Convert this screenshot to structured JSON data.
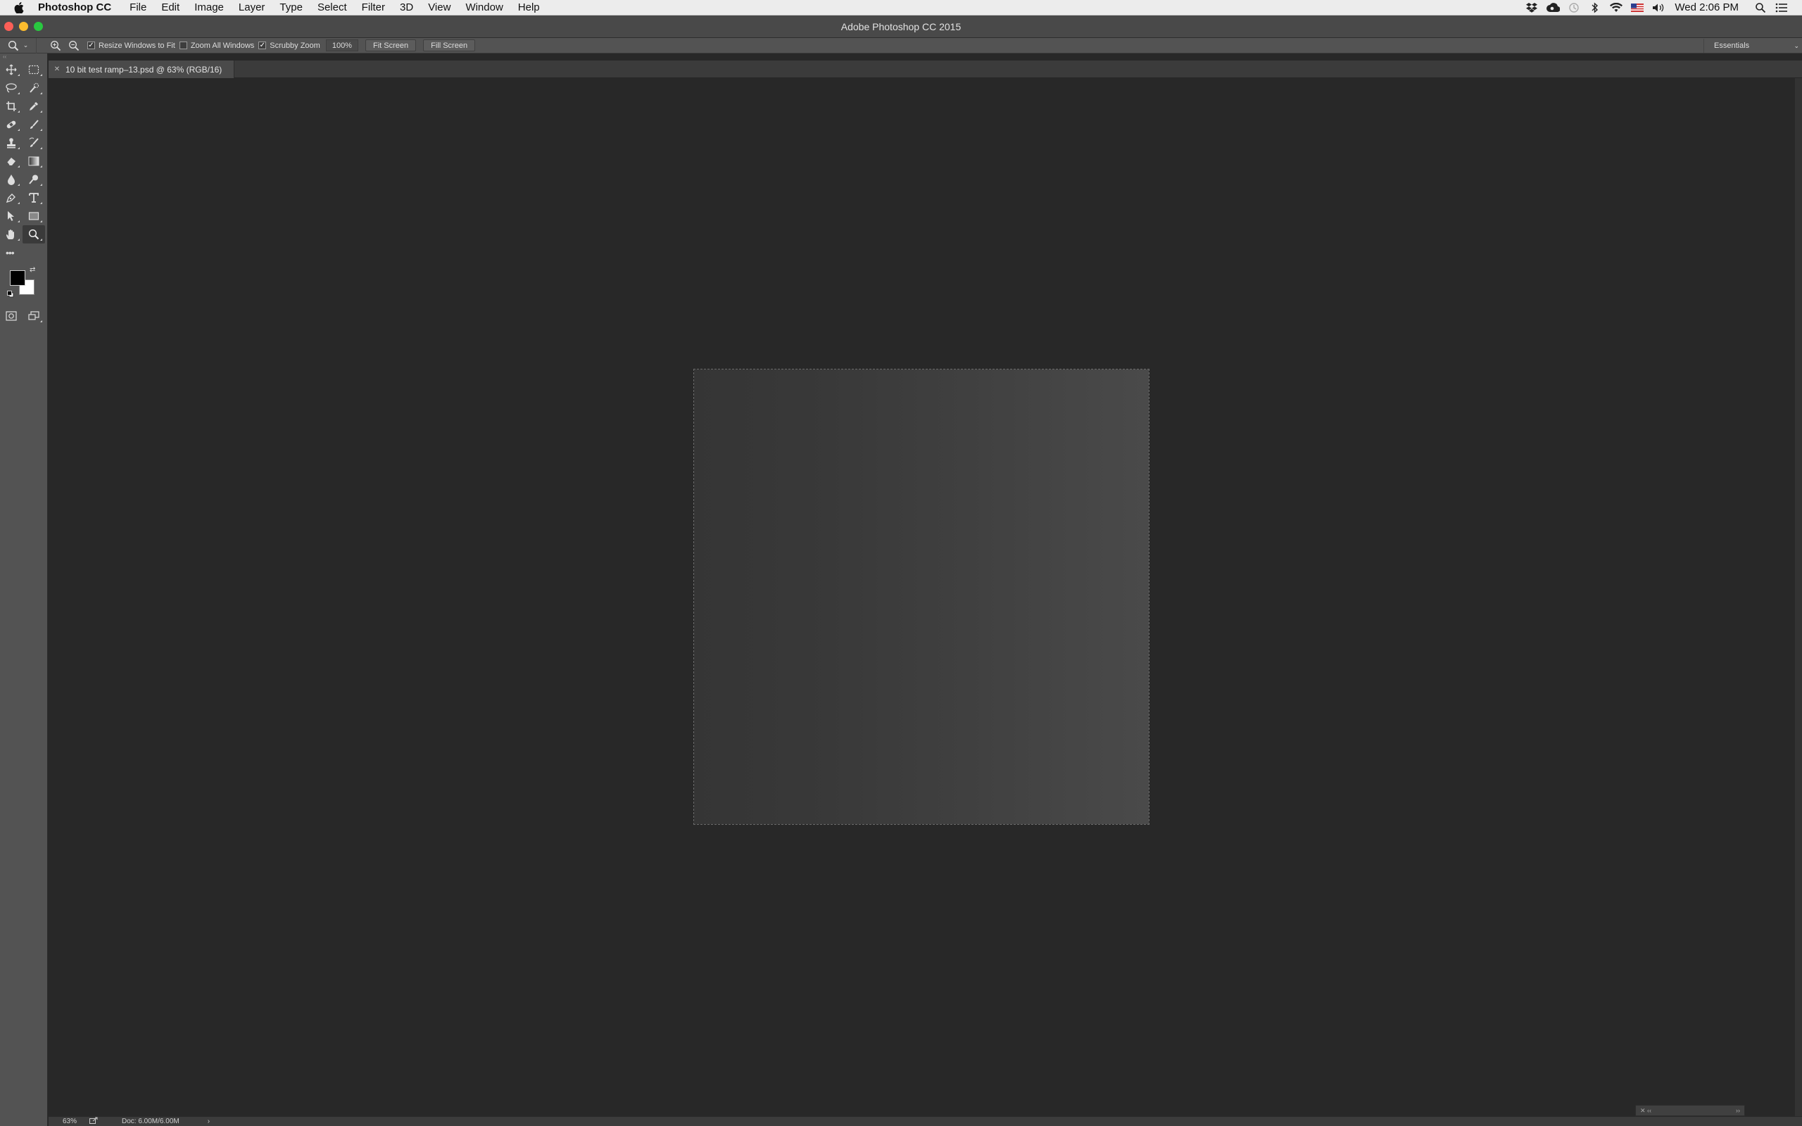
{
  "menubar": {
    "app_name": "Photoshop CC",
    "items": [
      "File",
      "Edit",
      "Image",
      "Layer",
      "Type",
      "Select",
      "Filter",
      "3D",
      "View",
      "Window",
      "Help"
    ],
    "clock": "Wed 2:06 PM",
    "status_icons": [
      "dropbox-icon",
      "creative-cloud-icon",
      "time-machine-icon",
      "bluetooth-icon",
      "wifi-icon",
      "us-flag-icon",
      "volume-icon"
    ]
  },
  "window": {
    "title": "Adobe Photoshop CC 2015",
    "traffic_colors": {
      "close": "#fc5f57",
      "minimize": "#fdbc2e",
      "maximize": "#29c840"
    }
  },
  "options": {
    "resize_windows_label": "Resize Windows to Fit",
    "resize_windows_checked": true,
    "zoom_all_windows_label": "Zoom All Windows",
    "zoom_all_windows_checked": false,
    "scrubby_zoom_label": "Scrubby Zoom",
    "scrubby_zoom_checked": true,
    "zoom_value": "100%",
    "fit_screen_label": "Fit Screen",
    "fill_screen_label": "Fill Screen",
    "workspace": "Essentials"
  },
  "document": {
    "tab_title": "10 bit test ramp–13.psd @ 63% (RGB/16)"
  },
  "status": {
    "zoom": "63%",
    "doc_info": "Doc: 6.00M/6.00M",
    "arrow": "›"
  },
  "colors": {
    "foreground": "#000000",
    "background": "#ffffff"
  }
}
